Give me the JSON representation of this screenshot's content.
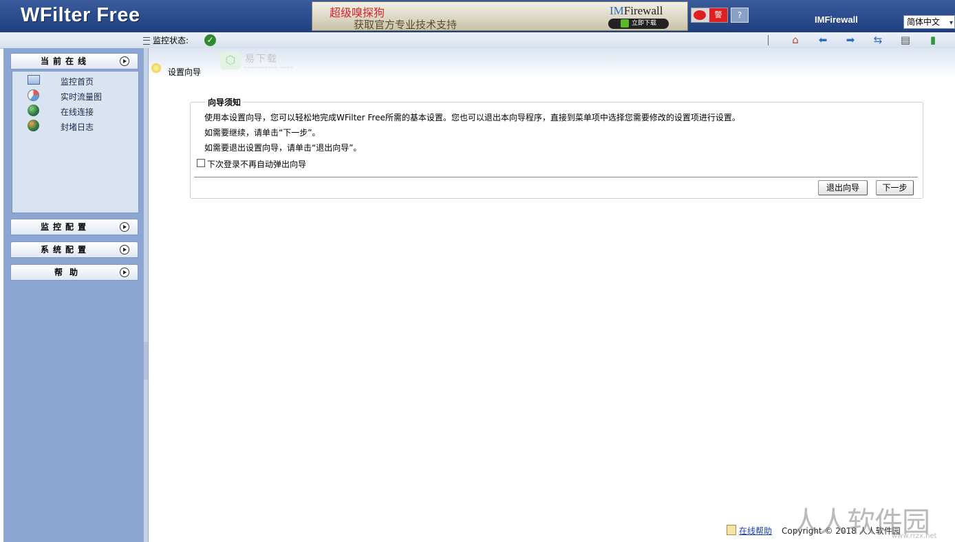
{
  "header": {
    "logo": "WFilter Free",
    "ad": {
      "title": "超级嗅探狗",
      "subtitle": "获取官方专业技术支持",
      "brand_prefix": "IM",
      "brand_suffix": "Firewall",
      "download_label": "立即下载"
    },
    "weibo_label": "警",
    "brand": "IMFirewall",
    "language": "简体中文"
  },
  "toolbar": {
    "status_label": "监控状态:",
    "status_icon": "check-icon",
    "buttons": [
      "home-icon",
      "back-icon",
      "forward-icon",
      "refresh-icon",
      "print-icon",
      "logout-icon"
    ]
  },
  "sidebar": {
    "sections": [
      {
        "label": "当前在线"
      },
      {
        "label": "监控配置"
      },
      {
        "label": "系统配置"
      },
      {
        "label": "帮助"
      }
    ],
    "items": [
      {
        "label": "监控首页",
        "icon": "monitor-icon"
      },
      {
        "label": "实时流量图",
        "icon": "pie-chart-icon"
      },
      {
        "label": "在线连接",
        "icon": "globe-icon"
      },
      {
        "label": "封堵日志",
        "icon": "globe-log-icon"
      }
    ]
  },
  "page": {
    "title": "设置向导",
    "watermark": "易下载",
    "watermark_sub": "~~~~~~~~~~ ~~~~"
  },
  "wizard": {
    "legend": "向导须知",
    "line1": "使用本设置向导，您可以轻松地完成WFilter Free所需的基本设置。您也可以退出本向导程序，直接到菜单项中选择您需要修改的设置项进行设置。",
    "line2": "如需要继续，请单击“下一步”。",
    "line3": "如需要退出设置向导，请单击“退出向导”。",
    "checkbox_label": "下次登录不再自动弹出向导",
    "checkbox_checked": false,
    "exit_button": "退出向导",
    "next_button": "下一步"
  },
  "footer": {
    "help_link": "在线帮助",
    "copyright": "Copyright © 2018 人人软件园"
  },
  "watermark": {
    "text": "人人软件园",
    "url": "www.rrzx.net"
  }
}
